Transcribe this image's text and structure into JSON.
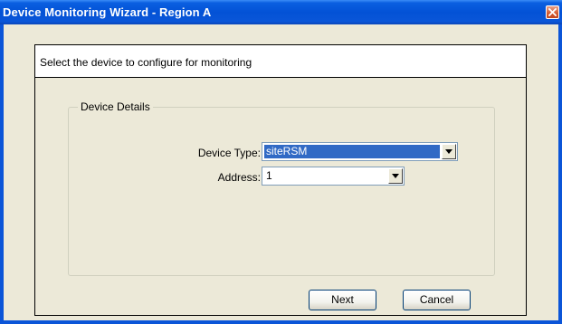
{
  "window": {
    "title": "Device Monitoring Wizard - Region A"
  },
  "header": {
    "instruction": "Select the device to configure for monitoring"
  },
  "device_details": {
    "group_label": "Device Details",
    "device_type_label": "Device Type:",
    "device_type_value": "siteRSM",
    "address_label": "Address:",
    "address_value": "1"
  },
  "buttons": {
    "next": "Next",
    "cancel": "Cancel"
  },
  "icons": {
    "close": "close-icon",
    "dropdown": "chevron-down-icon"
  },
  "colors": {
    "titlebar": "#0352d6",
    "selection": "#316ac5",
    "dialog_bg": "#ece9d8"
  }
}
